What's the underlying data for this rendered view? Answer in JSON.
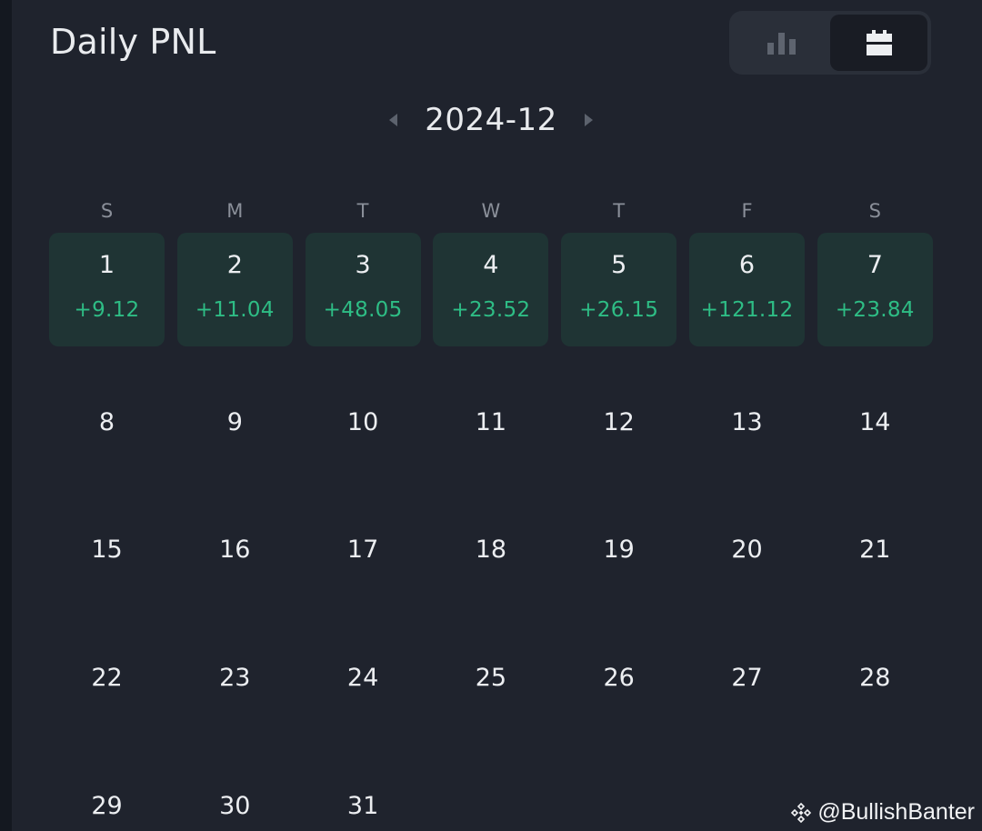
{
  "header": {
    "title": "Daily PNL"
  },
  "view_toggle": {
    "options": [
      {
        "icon": "bar-chart-icon",
        "active": false
      },
      {
        "icon": "calendar-icon",
        "active": true
      }
    ]
  },
  "month_nav": {
    "label": "2024-12"
  },
  "weekdays": [
    "S",
    "M",
    "T",
    "W",
    "T",
    "F",
    "S"
  ],
  "days": [
    {
      "day": "1",
      "pnl": "+9.12"
    },
    {
      "day": "2",
      "pnl": "+11.04"
    },
    {
      "day": "3",
      "pnl": "+48.05"
    },
    {
      "day": "4",
      "pnl": "+23.52"
    },
    {
      "day": "5",
      "pnl": "+26.15"
    },
    {
      "day": "6",
      "pnl": "+121.12"
    },
    {
      "day": "7",
      "pnl": "+23.84"
    },
    {
      "day": "8"
    },
    {
      "day": "9"
    },
    {
      "day": "10"
    },
    {
      "day": "11"
    },
    {
      "day": "12"
    },
    {
      "day": "13"
    },
    {
      "day": "14"
    },
    {
      "day": "15"
    },
    {
      "day": "16"
    },
    {
      "day": "17"
    },
    {
      "day": "18"
    },
    {
      "day": "19"
    },
    {
      "day": "20"
    },
    {
      "day": "21"
    },
    {
      "day": "22"
    },
    {
      "day": "23"
    },
    {
      "day": "24"
    },
    {
      "day": "25"
    },
    {
      "day": "26"
    },
    {
      "day": "27"
    },
    {
      "day": "28"
    },
    {
      "day": "29"
    },
    {
      "day": "30"
    },
    {
      "day": "31"
    }
  ],
  "colors": {
    "background": "#1f232d",
    "positive": "#2ebd85",
    "pnl_cell": "#1f3434",
    "text": "#eceef1",
    "muted": "#8a8f99"
  },
  "watermark": {
    "text": "@BullishBanter"
  }
}
